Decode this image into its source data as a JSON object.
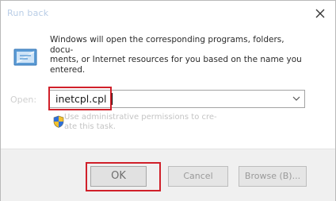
{
  "window": {
    "title": "Run back"
  },
  "description": "Windows will open the corresponding programs, folders, docu-ments, or Internet resources for you based on the name you entered.",
  "description_lines": [
    "Windows will open the corresponding programs, folders, docu-",
    "ments, or Internet resources for you based on the name you",
    "entered."
  ],
  "open_label": "Open:",
  "input": {
    "value": "inetcpl.cpl"
  },
  "admin_note_lines": [
    "Use administrative permissions to cre-",
    "ate this task."
  ],
  "buttons": {
    "ok": "OK",
    "cancel": "Cancel",
    "browse": "Browse (B)..."
  },
  "colors": {
    "highlight": "#d0202a",
    "title_text": "#b9cde6"
  },
  "icons": {
    "close": "close-icon",
    "app": "run-icon",
    "dropdown": "chevron-down-icon",
    "shield": "uac-shield-icon"
  }
}
